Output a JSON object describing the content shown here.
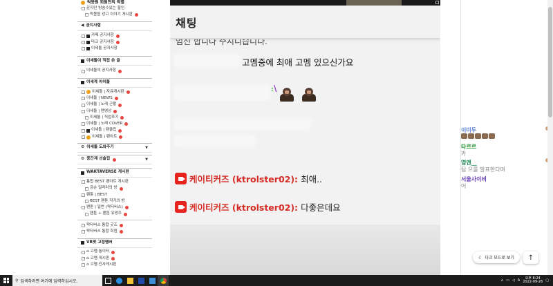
{
  "sidebar": {
    "top_title": "락몽원 회원전의 특별",
    "top_items": [
      "문지만 방송수있는 할인",
      "락몽원 광고 이야기 게시판"
    ],
    "notice_title": "공지사항",
    "notice_items": [
      "카페 공지사항",
      "마크 공지사항",
      "이세돌 공지사항"
    ],
    "direct_title": "이세돌이 직접 쓴 글",
    "direct_items": [
      "이세돌의 공지사항"
    ],
    "cafe_title": "이세계 아이돌",
    "cafe_items": [
      "이세돌 | 자유게시판",
      "이세돌 | NEWS",
      "이세돌 | 노래 근황",
      "이세돌 | 팬영상",
      "이세돌 | 직업후기",
      "이세돌 | 노래 COVER",
      "이세돌 | 팬클립",
      "이세돌 | 팬아트"
    ],
    "collapsed_1": "이세돌 도와주기",
    "collapsed_2": "중간계 선술집",
    "waktaverse_title": "WAKTAVERSE 게시판",
    "waktaverse_items": [
      "통합 BEST 팬아트 게시판",
      "금손 일러러의 방",
      "팬툰 | BEST",
      "BEST 팬툰 작가의 방",
      "팬툰 | 일반 (왁타버스)",
      "팬툰 + 팬툰 유망주"
    ],
    "wak_items_2": [
      "왁타버스 통합 굿즈",
      "왁타버스 통합 회원"
    ],
    "vr_title": "VR팟 고정멤버",
    "vr_items": [
      "고멤 놀이터",
      "고멤 게시판",
      "고멤 인사게시판"
    ]
  },
  "chat": {
    "title": "채팅",
    "partial_top": "엄신 합니다 수시니습니다.",
    "msg1": "고멤중에 최애 고멤 있으신가요",
    "yt_messages": [
      {
        "name": "케이티커즈 (ktrolster02):",
        "text": "최애.."
      },
      {
        "name": "케이티커즈 (ktrolster02):",
        "text": "다좋은데요"
      }
    ]
  },
  "right_chat": {
    "entries": [
      {
        "name": "이미두",
        "msg": "",
        "color": "#5b7fd1"
      },
      {
        "name": "타르르",
        "msg": "카",
        "color": "#2a9a3a"
      },
      {
        "name": "영엔__",
        "msg": "팀 으를 발표한다며",
        "color": "#1c8a55"
      },
      {
        "name": "서울사이비",
        "msg": "어",
        "color": "#6a3fb5"
      }
    ],
    "dark_mode_label": "다크 모드로 보기",
    "top_label": "↑"
  },
  "taskbar": {
    "search_placeholder": "검색하려면 여기에 입력하십시오.",
    "time": "오후 8:24",
    "date": "2022-09-26",
    "lang": "A"
  },
  "colors": {
    "yt_red": "#e6231d",
    "name_red": "#d62b24",
    "taskbar": "#1c1c1c"
  }
}
